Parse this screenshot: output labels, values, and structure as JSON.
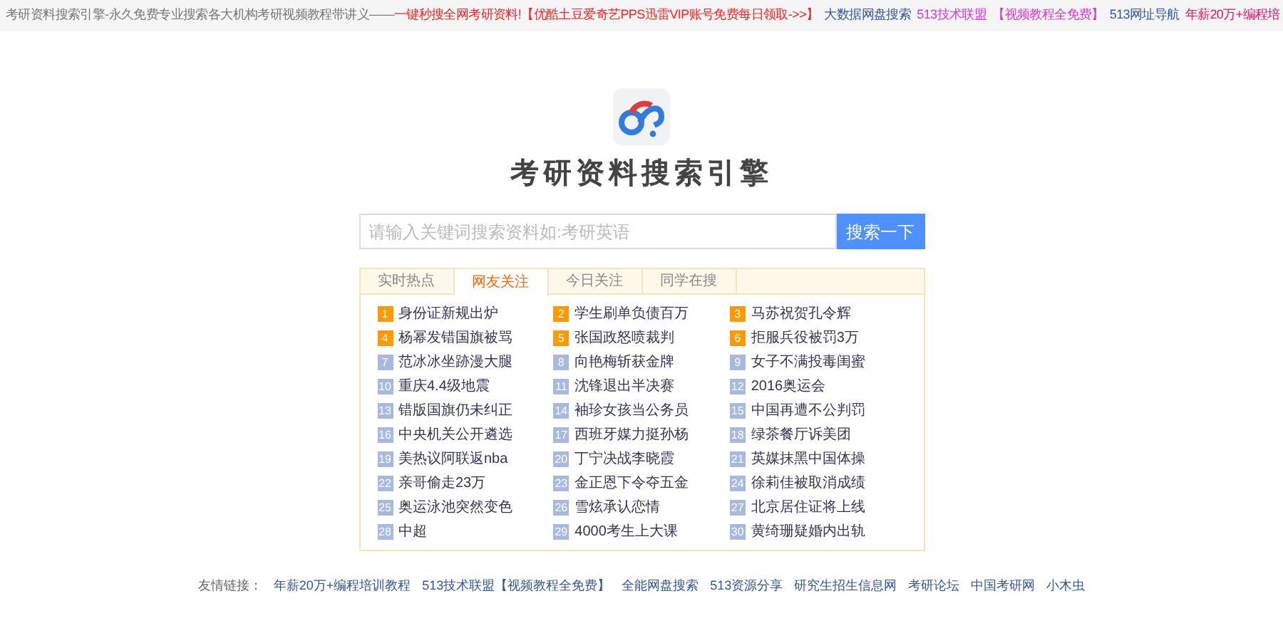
{
  "top_bar": {
    "site_title": "考研资料搜索引擎-永久免费专业搜索各大机构考研视频教程带讲义——",
    "promo": "一键秒搜全网考研资料!",
    "links": [
      {
        "label": "【优酷土豆爱奇艺PPS迅雷VIP账号免费每日领取->>】",
        "color": "#ff2222"
      },
      {
        "label": "大数据网盘搜索",
        "color": "#3355aa"
      },
      {
        "label": "513技术联盟",
        "color": "#dd33dd"
      },
      {
        "label": "【视频教程全免费】",
        "color": "#dd33dd"
      },
      {
        "label": "513网址导航",
        "color": "#3355aa"
      },
      {
        "label": "年薪20万+编程培",
        "color": "#ee1166"
      }
    ]
  },
  "title": "考研资料搜索引擎",
  "search": {
    "placeholder": "请输入关键词搜索资料如:考研英语",
    "button": "搜索一下"
  },
  "tabs": [
    {
      "label": "实时热点",
      "selected": false
    },
    {
      "label": "网友关注",
      "selected": true
    },
    {
      "label": "今日关注",
      "selected": false
    },
    {
      "label": "同学在搜",
      "selected": false
    }
  ],
  "hot_list": [
    {
      "rank": "1",
      "text": "身份证新规出炉",
      "color": "#ff9900"
    },
    {
      "rank": "2",
      "text": "学生刷单负债百万",
      "color": "#ff9900"
    },
    {
      "rank": "3",
      "text": "马苏祝贺孔令辉",
      "color": "#ff9900"
    },
    {
      "rank": "4",
      "text": "杨幂发错国旗被骂",
      "color": "#ff9900"
    },
    {
      "rank": "5",
      "text": "张国政怒喷裁判",
      "color": "#ff9900"
    },
    {
      "rank": "6",
      "text": "拒服兵役被罚3万",
      "color": "#ff9900"
    },
    {
      "rank": "7",
      "text": "范冰冰坐跡漫大腿",
      "color": "#a7b9e0"
    },
    {
      "rank": "8",
      "text": "向艳梅斩获金牌",
      "color": "#a7b9e0"
    },
    {
      "rank": "9",
      "text": "女子不满投毒闺蜜",
      "color": "#a7b9e0"
    },
    {
      "rank": "10",
      "text": "重庆4.4级地震",
      "color": "#a7b9e0"
    },
    {
      "rank": "11",
      "text": "沈锋退出半决赛",
      "color": "#a7b9e0"
    },
    {
      "rank": "12",
      "text": "2016奥运会",
      "color": "#a7b9e0"
    },
    {
      "rank": "13",
      "text": "错版国旗仍未纠正",
      "color": "#a7b9e0"
    },
    {
      "rank": "14",
      "text": "袖珍女孩当公务员",
      "color": "#a7b9e0"
    },
    {
      "rank": "15",
      "text": "中国再遭不公判罚",
      "color": "#a7b9e0"
    },
    {
      "rank": "16",
      "text": "中央机关公开遴选",
      "color": "#a7b9e0"
    },
    {
      "rank": "17",
      "text": "西班牙媒力挺孙杨",
      "color": "#a7b9e0"
    },
    {
      "rank": "18",
      "text": "绿茶餐厅诉美团",
      "color": "#a7b9e0"
    },
    {
      "rank": "19",
      "text": "美热议阿联返nba",
      "color": "#a7b9e0"
    },
    {
      "rank": "20",
      "text": "丁宁决战李晓霞",
      "color": "#a7b9e0"
    },
    {
      "rank": "21",
      "text": "英媒抹黑中国体操",
      "color": "#a7b9e0"
    },
    {
      "rank": "22",
      "text": "亲哥偷走23万",
      "color": "#a7b9e0"
    },
    {
      "rank": "23",
      "text": "金正恩下令夺五金",
      "color": "#a7b9e0"
    },
    {
      "rank": "24",
      "text": "徐莉佳被取消成绩",
      "color": "#a7b9e0"
    },
    {
      "rank": "25",
      "text": "奥运泳池突然变色",
      "color": "#a7b9e0"
    },
    {
      "rank": "26",
      "text": "雪炫承认恋情",
      "color": "#a7b9e0"
    },
    {
      "rank": "27",
      "text": "北京居住证将上线",
      "color": "#a7b9e0"
    },
    {
      "rank": "28",
      "text": "中超",
      "color": "#a7b9e0"
    },
    {
      "rank": "29",
      "text": "4000考生上大课",
      "color": "#a7b9e0"
    },
    {
      "rank": "30",
      "text": "黄绮珊疑婚内出轨",
      "color": "#a7b9e0"
    }
  ],
  "friend_links": {
    "label": "友情链接：",
    "links": [
      "年薪20万+编程培训教程",
      "513技术联盟【视频教程全免费】",
      "全能网盘搜索",
      "513资源分享",
      "研究生招生信息网",
      "考研论坛",
      "中国考研网",
      "小木虫"
    ]
  }
}
